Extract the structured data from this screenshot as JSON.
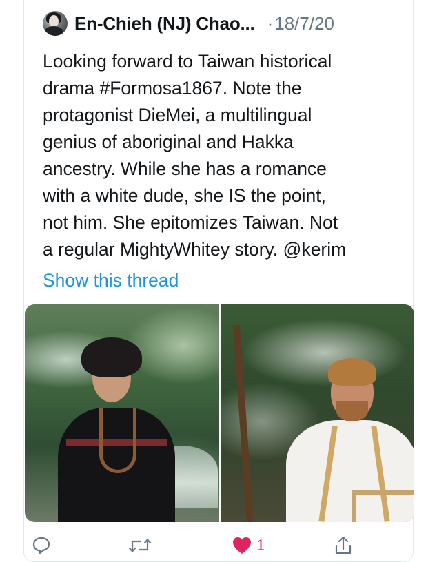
{
  "tweet": {
    "display_name": "En-Chieh (NJ) Chao...",
    "separator": "·",
    "date": "18/7/20",
    "text": "Looking forward to Taiwan historical\ndrama #Formosa1867. Note the\nprotagonist DieMei, a multilingual\ngenius of aboriginal and Hakka\nancestry. While she has a romance\nwith a white dude, she IS the point,\nnot him. She epitomizes Taiwan. Not\na regular MightyWhitey story. @kerim",
    "show_thread_label": "Show this thread"
  },
  "media": {
    "photos": [
      {
        "icon": "photo-woman-in-forest"
      },
      {
        "icon": "photo-man-in-forest"
      }
    ]
  },
  "actions": {
    "reply": {
      "icon": "reply-icon"
    },
    "retweet": {
      "icon": "retweet-icon"
    },
    "like": {
      "icon": "heart-icon",
      "count": "1",
      "color": "#e0245e"
    },
    "share": {
      "icon": "share-icon"
    }
  },
  "colors": {
    "link": "#1b95e0",
    "secondary_text": "#657786",
    "primary_text": "#14171a",
    "border": "#e1e8ed"
  }
}
